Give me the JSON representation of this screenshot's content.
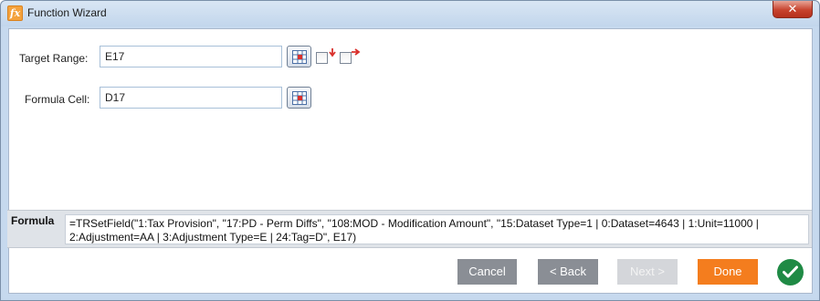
{
  "window": {
    "title": "Function Wizard",
    "icon": "fx-icon",
    "close_label": "✕"
  },
  "fields": {
    "target_range": {
      "label": "Target Range:",
      "value": "E17"
    },
    "formula_cell": {
      "label": "Formula Cell:",
      "value": "D17"
    }
  },
  "formula": {
    "label": "Formula",
    "text": "=TRSetField(\"1:Tax Provision\", \"17:PD - Perm Diffs\", \"108:MOD - Modification Amount\", \"15:Dataset Type=1 | 0:Dataset=4643 | 1:Unit=11000 | 2:Adjustment=AA | 3:Adjustment Type=E | 24:Tag=D\", E17)"
  },
  "buttons": {
    "cancel": "Cancel",
    "back": "< Back",
    "next": "Next >",
    "done": "Done"
  },
  "colors": {
    "accent_orange": "#f47d1e",
    "ok_green": "#1f8a45",
    "arrow_red": "#d9302c"
  }
}
